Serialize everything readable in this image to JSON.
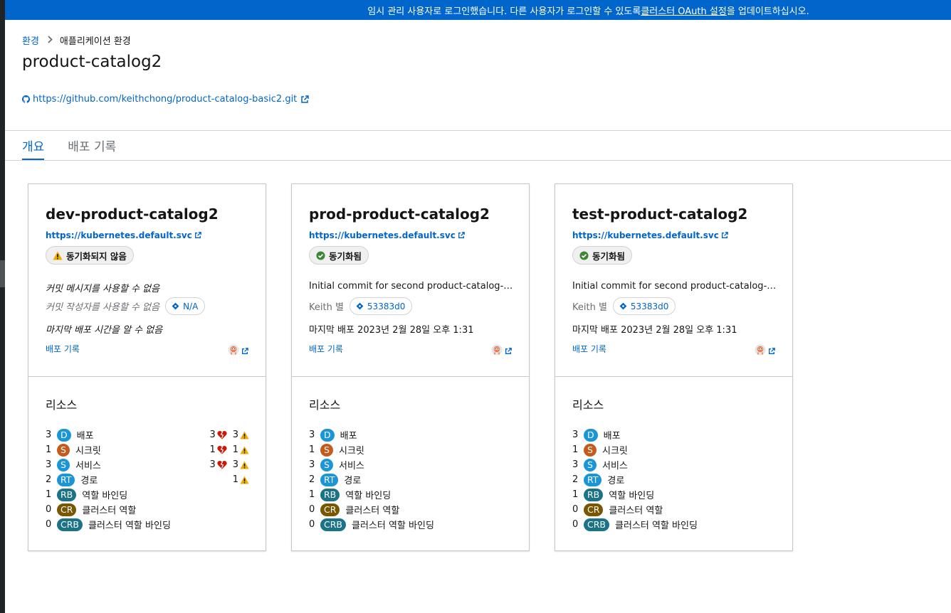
{
  "banner": {
    "text_before": "임시 관리 사용자로 로그인했습니다. 다른 사용자가 로그인할 수 있도록 ",
    "link": "클러스터 OAuth 설정",
    "text_after": "을 업데이트하십시오."
  },
  "breadcrumb": {
    "root": "환경",
    "current": "애플리케이션 환경"
  },
  "page": {
    "title": "product-catalog2",
    "repo_url": "https://github.com/keithchong/product-catalog-basic2.git"
  },
  "tabs": [
    "개요",
    "배포 기록"
  ],
  "cards": [
    {
      "name": "dev-product-catalog2",
      "cluster": "https://kubernetes.default.svc",
      "status": "동기화되지 않음",
      "status_type": "warning",
      "commit_message": "커밋 메시지를 사용할 수 없음",
      "author": "커밋 작성자를 사용할 수 없음",
      "sha": "N/A",
      "deploy_time": "마지막 배포 시간을 알 수 없음",
      "history_link": "배포 기록",
      "resources_title": "리소스",
      "resources": [
        {
          "count": "3",
          "abbr": "D",
          "name": "배포",
          "degraded": "3",
          "warnings": "3"
        },
        {
          "count": "1",
          "abbr": "S",
          "name": "시크릿",
          "degraded": "1",
          "warnings": "1"
        },
        {
          "count": "3",
          "abbr": "S",
          "name": "서비스",
          "degraded": "3",
          "warnings": "3"
        },
        {
          "count": "2",
          "abbr": "RT",
          "name": "경로",
          "degraded": "",
          "warnings": "1"
        },
        {
          "count": "1",
          "abbr": "RB",
          "name": "역할 바인딩",
          "degraded": "",
          "warnings": ""
        },
        {
          "count": "0",
          "abbr": "CR",
          "name": "클러스터 역할",
          "degraded": "",
          "warnings": ""
        },
        {
          "count": "0",
          "abbr": "CRB",
          "name": "클러스터 역할 바인딩",
          "degraded": "",
          "warnings": ""
        }
      ]
    },
    {
      "name": "prod-product-catalog2",
      "cluster": "https://kubernetes.default.svc",
      "status": "동기화됨",
      "status_type": "success",
      "commit_message": "Initial commit for second product-catalog-b...",
      "author": "Keith 별",
      "sha": "53383d0",
      "deploy_time": "마지막 배포 2023년 2월 28일 오후 1:31",
      "history_link": "배포 기록",
      "resources_title": "리소스",
      "resources": [
        {
          "count": "3",
          "abbr": "D",
          "name": "배포"
        },
        {
          "count": "1",
          "abbr": "S",
          "name": "시크릿"
        },
        {
          "count": "3",
          "abbr": "S",
          "name": "서비스"
        },
        {
          "count": "2",
          "abbr": "RT",
          "name": "경로"
        },
        {
          "count": "1",
          "abbr": "RB",
          "name": "역할 바인딩"
        },
        {
          "count": "0",
          "abbr": "CR",
          "name": "클러스터 역할"
        },
        {
          "count": "0",
          "abbr": "CRB",
          "name": "클러스터 역할 바인딩"
        }
      ]
    },
    {
      "name": "test-product-catalog2",
      "cluster": "https://kubernetes.default.svc",
      "status": "동기화됨",
      "status_type": "success",
      "commit_message": "Initial commit for second product-catalog-b...",
      "author": "Keith 별",
      "sha": "53383d0",
      "deploy_time": "마지막 배포 2023년 2월 28일 오후 1:31",
      "history_link": "배포 기록",
      "resources_title": "리소스",
      "resources": [
        {
          "count": "3",
          "abbr": "D",
          "name": "배포"
        },
        {
          "count": "1",
          "abbr": "S",
          "name": "시크릿"
        },
        {
          "count": "3",
          "abbr": "S",
          "name": "서비스"
        },
        {
          "count": "2",
          "abbr": "RT",
          "name": "경로"
        },
        {
          "count": "1",
          "abbr": "RB",
          "name": "역할 바인딩"
        },
        {
          "count": "0",
          "abbr": "CR",
          "name": "클러스터 역할"
        },
        {
          "count": "0",
          "abbr": "CRB",
          "name": "클러스터 역할 바인딩"
        }
      ]
    }
  ],
  "icons": {
    "github": "github-icon",
    "external_link": "external-link-icon",
    "warning": "warning-triangle-icon",
    "success": "check-circle-icon",
    "git_commit": "git-commit-icon",
    "degraded": "heart-broken-icon",
    "argo": "argo-cd-icon",
    "breadcrumb_sep": "chevron-right-icon"
  },
  "colors": {
    "banner": "#0066cc",
    "link": "#0066cc",
    "warning": "#f0ab00",
    "success": "#3e8635",
    "danger": "#c9190b",
    "kind_secret": "#c45a1b",
    "kind_blue": "#1a95d8",
    "kind_teal": "#1b7388",
    "kind_cluster_role": "#795600"
  }
}
